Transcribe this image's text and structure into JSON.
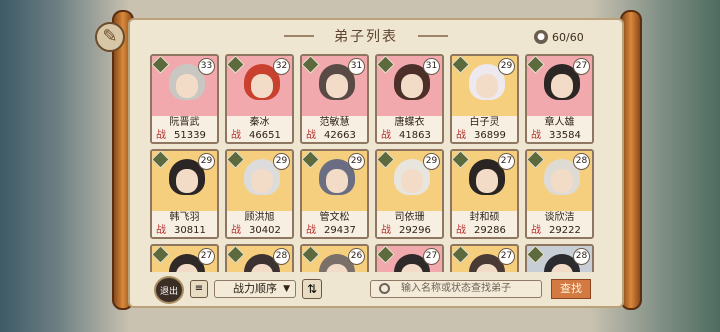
{
  "title": "弟子列表",
  "capacity": "60/60",
  "close_icon": "brush-icon",
  "disciples": [
    {
      "name": "阮晋武",
      "power": "51339",
      "level": "33",
      "bg": "#f2a9ae",
      "hair": "#c9c7c1"
    },
    {
      "name": "秦冰",
      "power": "46651",
      "level": "32",
      "bg": "#f2a9ae",
      "hair": "#c9402e"
    },
    {
      "name": "范敏慧",
      "power": "42663",
      "level": "31",
      "bg": "#f2a9ae",
      "hair": "#5a4a45"
    },
    {
      "name": "唐蝶衣",
      "power": "41863",
      "level": "31",
      "bg": "#f2a9ae",
      "hair": "#4c2f28"
    },
    {
      "name": "白子灵",
      "power": "36899",
      "level": "29",
      "bg": "#f6cf7e",
      "hair": "#ede9ee"
    },
    {
      "name": "章人雄",
      "power": "33584",
      "level": "27",
      "bg": "#f2a9ae",
      "hair": "#2c2624"
    },
    {
      "name": "韩飞羽",
      "power": "30811",
      "level": "29",
      "bg": "#f6cf7e",
      "hair": "#2b2525"
    },
    {
      "name": "顾洪旭",
      "power": "30402",
      "level": "29",
      "bg": "#f6cf7e",
      "hair": "#dcdcdc"
    },
    {
      "name": "管文松",
      "power": "29437",
      "level": "29",
      "bg": "#f6cf7e",
      "hair": "#6b6e82"
    },
    {
      "name": "司依珊",
      "power": "29296",
      "level": "29",
      "bg": "#f6cf7e",
      "hair": "#e7e5de"
    },
    {
      "name": "封和硕",
      "power": "29286",
      "level": "27",
      "bg": "#f6cf7e",
      "hair": "#2a2523"
    },
    {
      "name": "谈欣洁",
      "power": "29222",
      "level": "28",
      "bg": "#f6cf7e",
      "hair": "#dedbd5"
    },
    {
      "name": "",
      "power": "",
      "level": "27",
      "bg": "#f6cf7e",
      "hair": "#2f2a28"
    },
    {
      "name": "",
      "power": "",
      "level": "28",
      "bg": "#f6cf7e",
      "hair": "#3b3231"
    },
    {
      "name": "",
      "power": "",
      "level": "26",
      "bg": "#f6cf7e",
      "hair": "#7b6f6a"
    },
    {
      "name": "",
      "power": "",
      "level": "27",
      "bg": "#f2a9ae",
      "hair": "#2f2a2a"
    },
    {
      "name": "",
      "power": "",
      "level": "27",
      "bg": "#f6cf7e",
      "hair": "#4a3a36"
    },
    {
      "name": "",
      "power": "",
      "level": "28",
      "bg": "#c8ced6",
      "hair": "#2b2a2e"
    }
  ],
  "power_label": "战",
  "exit_label": "退出",
  "sort": {
    "label": "战力顺序",
    "icon": "list-icon",
    "order_icon": "swap-icon"
  },
  "search": {
    "placeholder": "输入名称或状态查找弟子"
  },
  "find_label": "查找"
}
